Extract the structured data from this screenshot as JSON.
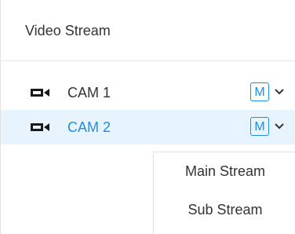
{
  "panel": {
    "title": "Video Stream"
  },
  "cameras": [
    {
      "label": "CAM 1",
      "stream_badge": "M",
      "selected": false
    },
    {
      "label": "CAM 2",
      "stream_badge": "M",
      "selected": true
    }
  ],
  "stream_menu": {
    "options": [
      "Main Stream",
      "Sub Stream"
    ]
  },
  "colors": {
    "accent": "#1c8fe8",
    "selected_row_bg": "#e7f3fd",
    "text": "#333333"
  },
  "icons": {
    "camera": "video-camera-icon",
    "dropdown": "chevron-down-icon"
  }
}
